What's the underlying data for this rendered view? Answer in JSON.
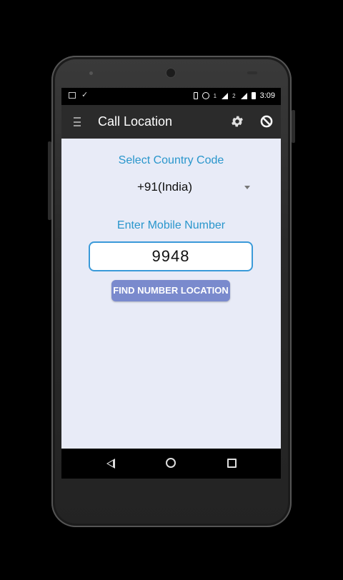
{
  "status_bar": {
    "sim1": "1",
    "sim2": "2",
    "time": "3:09"
  },
  "app_bar": {
    "title": "Call Location",
    "icons": [
      "menu-icon",
      "gear-icon",
      "block-icon"
    ]
  },
  "form": {
    "country_label": "Select Country Code",
    "country_value": "+91(India)",
    "mobile_label": "Enter Mobile Number",
    "mobile_value": "9948",
    "find_button": "FIND NUMBER LOCATION"
  },
  "nav_bar": {
    "icons": [
      "back-icon",
      "home-icon",
      "recent-apps-icon"
    ]
  },
  "colors": {
    "accent_blue": "#2996cc",
    "button": "#7a8acd",
    "content_bg": "#e8ebf7",
    "app_bar": "#2b2b2b"
  }
}
